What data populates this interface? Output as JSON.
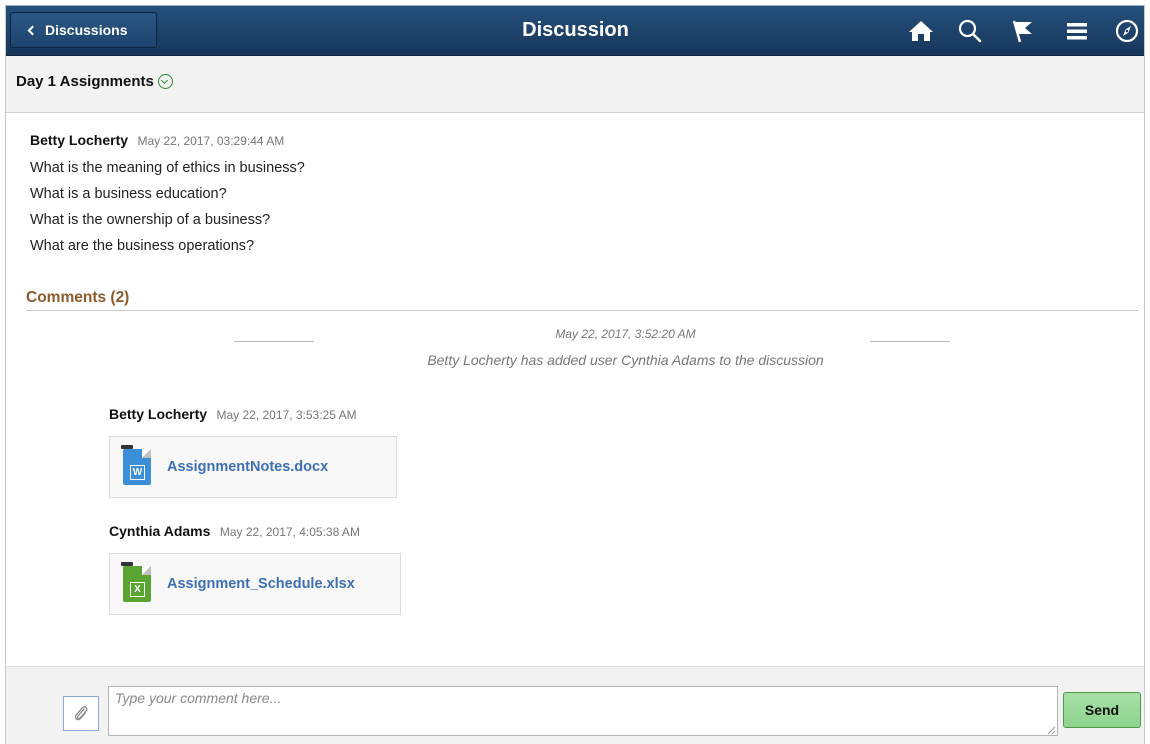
{
  "banner": {
    "back_label": "Discussions",
    "title": "Discussion",
    "icons": [
      "home-icon",
      "search-icon",
      "flag-icon",
      "menu-icon",
      "compass-icon"
    ]
  },
  "subheader": {
    "title": "Day 1 Assignments"
  },
  "post": {
    "author": "Betty Locherty",
    "timestamp": "May 22, 2017,  03:29:44 AM",
    "lines": [
      "What is the meaning of ethics in business?",
      "What is a business education?",
      "What is the ownership of a business?",
      "What are the business operations?"
    ]
  },
  "comments": {
    "header": "Comments (2)",
    "system": {
      "timestamp": "May 22, 2017,  3:52:20 AM",
      "message": "Betty Locherty has added user Cynthia Adams to the discussion"
    },
    "items": [
      {
        "author": "Betty Locherty",
        "timestamp": "May 22, 2017,  3:53:25 AM",
        "attachment": "AssignmentNotes.docx",
        "file_type": "word-doc-icon",
        "file_letter": "W",
        "file_color": "#3b8fd9"
      },
      {
        "author": "Cynthia Adams",
        "timestamp": "May 22, 2017,  4:05:38 AM",
        "attachment": "Assignment_Schedule.xlsx",
        "file_type": "excel-doc-icon",
        "file_letter": "X",
        "file_color": "#5aa532"
      }
    ]
  },
  "footer": {
    "placeholder": "Type your comment here...",
    "send_label": "Send"
  },
  "colors": {
    "banner": "#1e3f66",
    "comments_header": "#8c5a2b",
    "link": "#3d6fb5",
    "send_button": "#9ad89a"
  }
}
